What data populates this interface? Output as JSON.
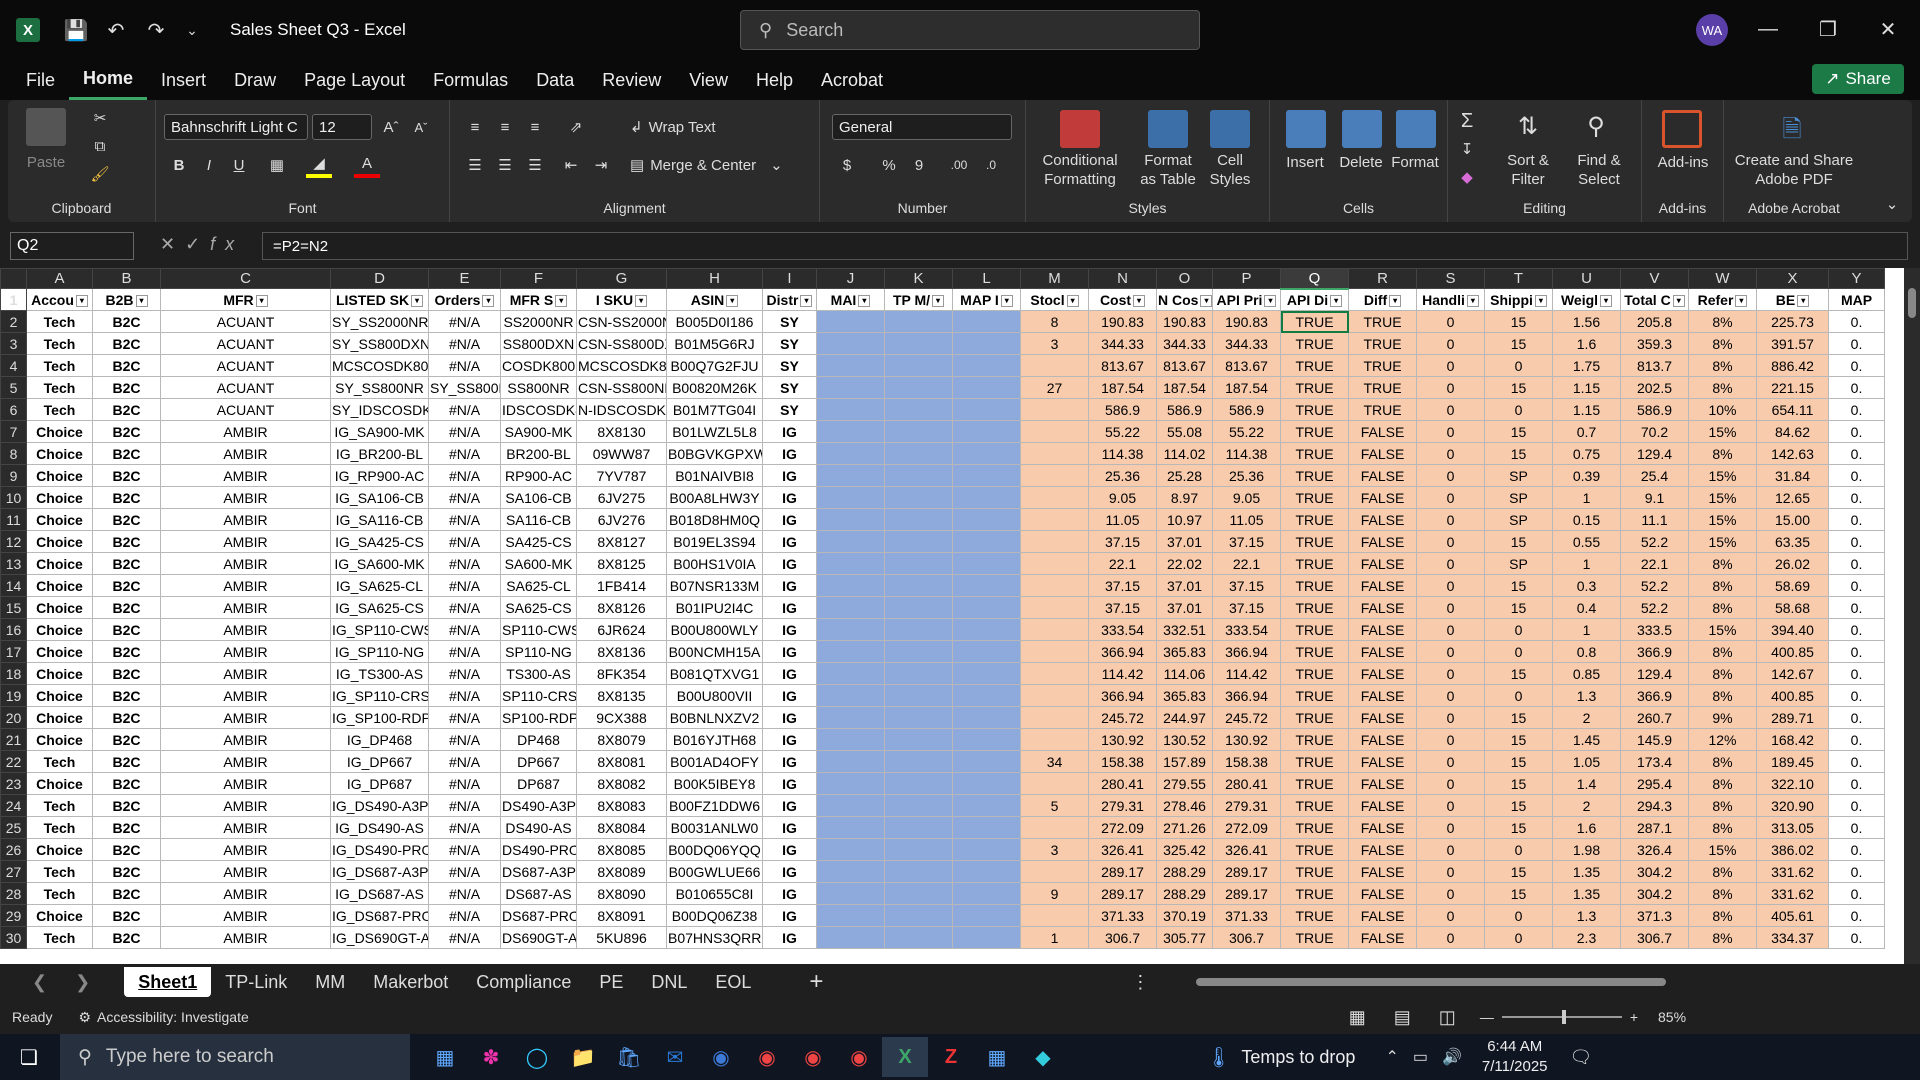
{
  "window": {
    "title": "Sales Sheet Q3 - Excel",
    "search_placeholder": "Search",
    "avatar": "WA",
    "share": "Share"
  },
  "menu": [
    "File",
    "Home",
    "Insert",
    "Draw",
    "Page Layout",
    "Formulas",
    "Data",
    "Review",
    "View",
    "Help",
    "Acrobat"
  ],
  "ribbon": {
    "clipboard": {
      "label": "Clipboard",
      "paste": "Paste"
    },
    "font": {
      "label": "Font",
      "name": "Bahnschrift Light C",
      "size": "12"
    },
    "alignment": {
      "label": "Alignment",
      "wrap": "Wrap Text",
      "merge": "Merge & Center"
    },
    "number": {
      "label": "Number",
      "format": "General"
    },
    "styles": {
      "label": "Styles",
      "cond": "Conditional Formatting",
      "table": "Format as Table",
      "cell": "Cell Styles"
    },
    "cells": {
      "label": "Cells",
      "insert": "Insert",
      "delete": "Delete",
      "format": "Format"
    },
    "editing": {
      "label": "Editing",
      "sort": "Sort & Filter",
      "find": "Find & Select"
    },
    "addins": {
      "label": "Add-ins",
      "btn": "Add-ins"
    },
    "acrobat": {
      "label": "Adobe Acrobat",
      "btn": "Create and Share Adobe PDF"
    }
  },
  "formula": {
    "namebox": "Q2",
    "text": "=P2=N2"
  },
  "columns": [
    "A",
    "B",
    "C",
    "D",
    "E",
    "F",
    "G",
    "H",
    "I",
    "J",
    "K",
    "L",
    "M",
    "N",
    "O",
    "P",
    "Q",
    "R",
    "S",
    "T",
    "U",
    "V",
    "W",
    "X",
    "Y"
  ],
  "headers": [
    "Accou",
    "B2B",
    "MFR",
    "LISTED SK",
    "Orders",
    "MFR S",
    "I SKU",
    "ASIN",
    "Distr",
    "MAI",
    "TP M/",
    "MAP I",
    "Stocl",
    "Cost",
    "N Cos",
    "API Pri",
    "API Di",
    "Diff",
    "Handli",
    "Shippi",
    "Weigl",
    "Total C",
    "Refer",
    "BE",
    "MAP"
  ],
  "rows": [
    [
      "2",
      "Tech",
      "B2C",
      "ACUANT",
      "SY_SS2000NR",
      "#N/A",
      "SS2000NR",
      "CSN-SS2000NR",
      "B005D0I186",
      "SY",
      "",
      "",
      "",
      "8",
      "190.83",
      "190.83",
      "190.83",
      "TRUE",
      "TRUE",
      "0",
      "15",
      "1.56",
      "205.8",
      "8%",
      "225.73",
      "0."
    ],
    [
      "3",
      "Tech",
      "B2C",
      "ACUANT",
      "SY_SS800DXN",
      "#N/A",
      "SS800DXN",
      "CSN-SS800DXN",
      "B01M5G6RJ",
      "SY",
      "",
      "",
      "",
      "3",
      "344.33",
      "344.33",
      "344.33",
      "TRUE",
      "TRUE",
      "0",
      "15",
      "1.6",
      "359.3",
      "8%",
      "391.57",
      "0."
    ],
    [
      "4",
      "Tech",
      "B2C",
      "ACUANT",
      "MCSCOSDK800DX-",
      "#N/A",
      "COSDK800DX",
      "MCSCOSDK800D",
      "B00Q7G2FJU",
      "SY",
      "",
      "",
      "",
      "",
      "813.67",
      "813.67",
      "813.67",
      "TRUE",
      "TRUE",
      "0",
      "0",
      "1.75",
      "813.7",
      "8%",
      "886.42",
      "0."
    ],
    [
      "5",
      "Tech",
      "B2C",
      "ACUANT",
      "SY_SS800NR",
      "SY_SS800NR",
      "SS800NR",
      "CSN-SS800NR",
      "B00820M26K",
      "SY",
      "",
      "",
      "",
      "27",
      "187.54",
      "187.54",
      "187.54",
      "TRUE",
      "TRUE",
      "0",
      "15",
      "1.15",
      "202.5",
      "8%",
      "221.15",
      "0."
    ],
    [
      "6",
      "Tech",
      "B2C",
      "ACUANT",
      "SY_IDSCOSDK800F",
      "#N/A",
      "IDSCOSDK800",
      "N-IDSCOSDK80",
      "B01M7TG04I",
      "SY",
      "",
      "",
      "",
      "",
      "586.9",
      "586.9",
      "586.9",
      "TRUE",
      "TRUE",
      "0",
      "0",
      "1.15",
      "586.9",
      "10%",
      "654.11",
      "0."
    ],
    [
      "7",
      "Choice",
      "B2C",
      "AMBIR",
      "IG_SA900-MK",
      "#N/A",
      "SA900-MK",
      "8X8130",
      "B01LWZL5L8",
      "IG",
      "",
      "",
      "",
      "",
      "55.22",
      "55.08",
      "55.22",
      "TRUE",
      "FALSE",
      "0",
      "15",
      "0.7",
      "70.2",
      "15%",
      "84.62",
      "0."
    ],
    [
      "8",
      "Choice",
      "B2C",
      "AMBIR",
      "IG_BR200-BL",
      "#N/A",
      "BR200-BL",
      "09WW87",
      "B0BGVKGPXW",
      "IG",
      "",
      "",
      "",
      "",
      "114.38",
      "114.02",
      "114.38",
      "TRUE",
      "FALSE",
      "0",
      "15",
      "0.75",
      "129.4",
      "8%",
      "142.63",
      "0."
    ],
    [
      "9",
      "Choice",
      "B2C",
      "AMBIR",
      "IG_RP900-AC",
      "#N/A",
      "RP900-AC",
      "7YV787",
      "B01NAIVBI8",
      "IG",
      "",
      "",
      "",
      "",
      "25.36",
      "25.28",
      "25.36",
      "TRUE",
      "FALSE",
      "0",
      "SP",
      "0.39",
      "25.4",
      "15%",
      "31.84",
      "0."
    ],
    [
      "10",
      "Choice",
      "B2C",
      "AMBIR",
      "IG_SA106-CB",
      "#N/A",
      "SA106-CB",
      "6JV275",
      "B00A8LHW3Y",
      "IG",
      "",
      "",
      "",
      "",
      "9.05",
      "8.97",
      "9.05",
      "TRUE",
      "FALSE",
      "0",
      "SP",
      "1",
      "9.1",
      "15%",
      "12.65",
      "0."
    ],
    [
      "11",
      "Choice",
      "B2C",
      "AMBIR",
      "IG_SA116-CB",
      "#N/A",
      "SA116-CB",
      "6JV276",
      "B018D8HM0Q",
      "IG",
      "",
      "",
      "",
      "",
      "11.05",
      "10.97",
      "11.05",
      "TRUE",
      "FALSE",
      "0",
      "SP",
      "0.15",
      "11.1",
      "15%",
      "15.00",
      "0."
    ],
    [
      "12",
      "Choice",
      "B2C",
      "AMBIR",
      "IG_SA425-CS",
      "#N/A",
      "SA425-CS",
      "8X8127",
      "B019EL3S94",
      "IG",
      "",
      "",
      "",
      "",
      "37.15",
      "37.01",
      "37.15",
      "TRUE",
      "FALSE",
      "0",
      "15",
      "0.55",
      "52.2",
      "15%",
      "63.35",
      "0."
    ],
    [
      "13",
      "Choice",
      "B2C",
      "AMBIR",
      "IG_SA600-MK",
      "#N/A",
      "SA600-MK",
      "8X8125",
      "B00HS1V0IA",
      "IG",
      "",
      "",
      "",
      "",
      "22.1",
      "22.02",
      "22.1",
      "TRUE",
      "FALSE",
      "0",
      "SP",
      "1",
      "22.1",
      "8%",
      "26.02",
      "0."
    ],
    [
      "14",
      "Choice",
      "B2C",
      "AMBIR",
      "IG_SA625-CL",
      "#N/A",
      "SA625-CL",
      "1FB414",
      "B07NSR133M",
      "IG",
      "",
      "",
      "",
      "",
      "37.15",
      "37.01",
      "37.15",
      "TRUE",
      "FALSE",
      "0",
      "15",
      "0.3",
      "52.2",
      "8%",
      "58.69",
      "0."
    ],
    [
      "15",
      "Choice",
      "B2C",
      "AMBIR",
      "IG_SA625-CS",
      "#N/A",
      "SA625-CS",
      "8X8126",
      "B01IPU2I4C",
      "IG",
      "",
      "",
      "",
      "",
      "37.15",
      "37.01",
      "37.15",
      "TRUE",
      "FALSE",
      "0",
      "15",
      "0.4",
      "52.2",
      "8%",
      "58.68",
      "0."
    ],
    [
      "16",
      "Choice",
      "B2C",
      "AMBIR",
      "IG_SP110-CWS",
      "#N/A",
      "SP110-CWS",
      "6JR624",
      "B00U800WLY",
      "IG",
      "",
      "",
      "",
      "",
      "333.54",
      "332.51",
      "333.54",
      "TRUE",
      "FALSE",
      "0",
      "0",
      "1",
      "333.5",
      "15%",
      "394.40",
      "0."
    ],
    [
      "17",
      "Choice",
      "B2C",
      "AMBIR",
      "IG_SP110-NG",
      "#N/A",
      "SP110-NG",
      "8X8136",
      "B00NCMH15A",
      "IG",
      "",
      "",
      "",
      "",
      "366.94",
      "365.83",
      "366.94",
      "TRUE",
      "FALSE",
      "0",
      "0",
      "0.8",
      "366.9",
      "8%",
      "400.85",
      "0."
    ],
    [
      "18",
      "Choice",
      "B2C",
      "AMBIR",
      "IG_TS300-AS",
      "#N/A",
      "TS300-AS",
      "8FK354",
      "B081QTXVG1",
      "IG",
      "",
      "",
      "",
      "",
      "114.42",
      "114.06",
      "114.42",
      "TRUE",
      "FALSE",
      "0",
      "15",
      "0.85",
      "129.4",
      "8%",
      "142.67",
      "0."
    ],
    [
      "19",
      "Choice",
      "B2C",
      "AMBIR",
      "IG_SP110-CRS",
      "#N/A",
      "SP110-CRS",
      "8X8135",
      "B00U800VII",
      "IG",
      "",
      "",
      "",
      "",
      "366.94",
      "365.83",
      "366.94",
      "TRUE",
      "FALSE",
      "0",
      "0",
      "1.3",
      "366.9",
      "8%",
      "400.85",
      "0."
    ],
    [
      "20",
      "Choice",
      "B2C",
      "AMBIR",
      "IG_SP100-RDP",
      "#N/A",
      "SP100-RDP",
      "9CX388",
      "B0BNLNXZV2",
      "IG",
      "",
      "",
      "",
      "",
      "245.72",
      "244.97",
      "245.72",
      "TRUE",
      "FALSE",
      "0",
      "15",
      "2",
      "260.7",
      "9%",
      "289.71",
      "0."
    ],
    [
      "21",
      "Choice",
      "B2C",
      "AMBIR",
      "IG_DP468",
      "#N/A",
      "DP468",
      "8X8079",
      "B016YJTH68",
      "IG",
      "",
      "",
      "",
      "",
      "130.92",
      "130.52",
      "130.92",
      "TRUE",
      "FALSE",
      "0",
      "15",
      "1.45",
      "145.9",
      "12%",
      "168.42",
      "0."
    ],
    [
      "22",
      "Tech",
      "B2C",
      "AMBIR",
      "IG_DP667",
      "#N/A",
      "DP667",
      "8X8081",
      "B001AD4OFY",
      "IG",
      "",
      "",
      "",
      "34",
      "158.38",
      "157.89",
      "158.38",
      "TRUE",
      "FALSE",
      "0",
      "15",
      "1.05",
      "173.4",
      "8%",
      "189.45",
      "0."
    ],
    [
      "23",
      "Choice",
      "B2C",
      "AMBIR",
      "IG_DP687",
      "#N/A",
      "DP687",
      "8X8082",
      "B00K5IBEY8",
      "IG",
      "",
      "",
      "",
      "",
      "280.41",
      "279.55",
      "280.41",
      "TRUE",
      "FALSE",
      "0",
      "15",
      "1.4",
      "295.4",
      "8%",
      "322.10",
      "0."
    ],
    [
      "24",
      "Tech",
      "B2C",
      "AMBIR",
      "IG_DS490-A3P",
      "#N/A",
      "DS490-A3P",
      "8X8083",
      "B00FZ1DDW6",
      "IG",
      "",
      "",
      "",
      "5",
      "279.31",
      "278.46",
      "279.31",
      "TRUE",
      "FALSE",
      "0",
      "15",
      "2",
      "294.3",
      "8%",
      "320.90",
      "0."
    ],
    [
      "25",
      "Tech",
      "B2C",
      "AMBIR",
      "IG_DS490-AS",
      "#N/A",
      "DS490-AS",
      "8X8084",
      "B0031ANLW0",
      "IG",
      "",
      "",
      "",
      "",
      "272.09",
      "271.26",
      "272.09",
      "TRUE",
      "FALSE",
      "0",
      "15",
      "1.6",
      "287.1",
      "8%",
      "313.05",
      "0."
    ],
    [
      "26",
      "Choice",
      "B2C",
      "AMBIR",
      "IG_DS490-PRO",
      "#N/A",
      "DS490-PRO",
      "8X8085",
      "B00DQ06YQQ",
      "IG",
      "",
      "",
      "",
      "3",
      "326.41",
      "325.42",
      "326.41",
      "TRUE",
      "FALSE",
      "0",
      "0",
      "1.98",
      "326.4",
      "15%",
      "386.02",
      "0."
    ],
    [
      "27",
      "Tech",
      "B2C",
      "AMBIR",
      "IG_DS687-A3P",
      "#N/A",
      "DS687-A3P",
      "8X8089",
      "B00GWLUE66",
      "IG",
      "",
      "",
      "",
      "",
      "289.17",
      "288.29",
      "289.17",
      "TRUE",
      "FALSE",
      "0",
      "15",
      "1.35",
      "304.2",
      "8%",
      "331.62",
      "0."
    ],
    [
      "28",
      "Tech",
      "B2C",
      "AMBIR",
      "IG_DS687-AS",
      "#N/A",
      "DS687-AS",
      "8X8090",
      "B010655C8I",
      "IG",
      "",
      "",
      "",
      "9",
      "289.17",
      "288.29",
      "289.17",
      "TRUE",
      "FALSE",
      "0",
      "15",
      "1.35",
      "304.2",
      "8%",
      "331.62",
      "0."
    ],
    [
      "29",
      "Choice",
      "B2C",
      "AMBIR",
      "IG_DS687-PRO",
      "#N/A",
      "DS687-PRO",
      "8X8091",
      "B00DQ06Z38",
      "IG",
      "",
      "",
      "",
      "",
      "371.33",
      "370.19",
      "371.33",
      "TRUE",
      "FALSE",
      "0",
      "0",
      "1.3",
      "371.3",
      "8%",
      "405.61",
      "0."
    ],
    [
      "30",
      "Tech",
      "B2C",
      "AMBIR",
      "IG_DS690GT-AS",
      "#N/A",
      "DS690GT-AS",
      "5KU896",
      "B07HNS3QRR",
      "IG",
      "",
      "",
      "",
      "1",
      "306.7",
      "305.77",
      "306.7",
      "TRUE",
      "FALSE",
      "0",
      "0",
      "2.3",
      "306.7",
      "8%",
      "334.37",
      "0."
    ]
  ],
  "sheets": [
    "Sheet1",
    "TP-Link",
    "MM",
    "Makerbot",
    "Compliance",
    "PE",
    "DNL",
    "EOL"
  ],
  "status": {
    "ready": "Ready",
    "accessibility": "Accessibility: Investigate",
    "zoom": "85%"
  },
  "taskbar": {
    "search": "Type here to search",
    "weather": "Temps to drop",
    "time": "6:44 AM",
    "date": "7/11/2025"
  },
  "colors": {
    "orange": "#f8cbad",
    "blue": "#8ea9db",
    "accent": "#107c41"
  }
}
